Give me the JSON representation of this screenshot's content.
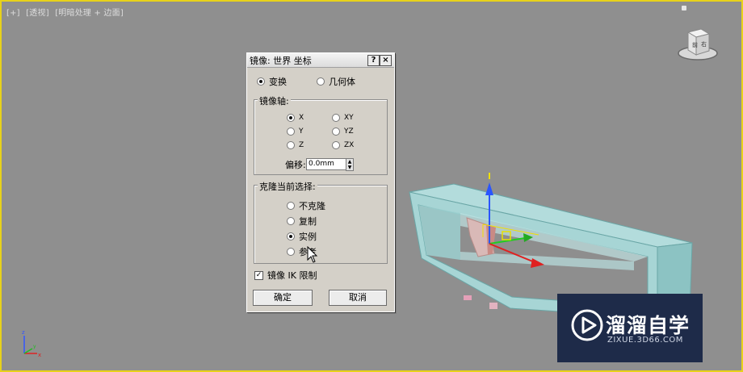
{
  "viewport": {
    "label_parts": [
      "[+]",
      "[透视]",
      "[明暗处理 + 边面]"
    ],
    "border_color": "#e8d21a",
    "background": "#8f8f8f",
    "viewcube_faces": [
      "前",
      "右"
    ]
  },
  "dialog": {
    "title": "镜像: 世界 坐标",
    "help_button": "?",
    "close_button": "×",
    "mode_options": [
      {
        "label": "变换",
        "selected": true
      },
      {
        "label": "几何体",
        "selected": false
      }
    ],
    "axis_group": {
      "title": "镜像轴:",
      "options": [
        {
          "label": "X",
          "selected": true
        },
        {
          "label": "XY",
          "selected": false
        },
        {
          "label": "Y",
          "selected": false
        },
        {
          "label": "YZ",
          "selected": false
        },
        {
          "label": "Z",
          "selected": false
        },
        {
          "label": "ZX",
          "selected": false
        }
      ],
      "offset_label": "偏移:",
      "offset_value": "0.0mm"
    },
    "clone_group": {
      "title": "克隆当前选择:",
      "options": [
        {
          "label": "不克隆",
          "selected": false
        },
        {
          "label": "复制",
          "selected": false
        },
        {
          "label": "实例",
          "selected": true
        },
        {
          "label": "参考",
          "selected": false
        }
      ]
    },
    "ik_checkbox": {
      "label": "镜像 IK 限制",
      "checked": true
    },
    "ok_button": "确定",
    "cancel_button": "取消"
  },
  "watermark": {
    "title": "溜溜自学",
    "url": "ZIXUE.3D66.COM"
  },
  "axis_labels": {
    "z": "z",
    "x": "x",
    "y": "y"
  },
  "icons": [
    "viewcube-icon",
    "move-gizmo-icon",
    "axis-tripod-icon",
    "mouse-cursor-icon",
    "play-logo-icon"
  ]
}
